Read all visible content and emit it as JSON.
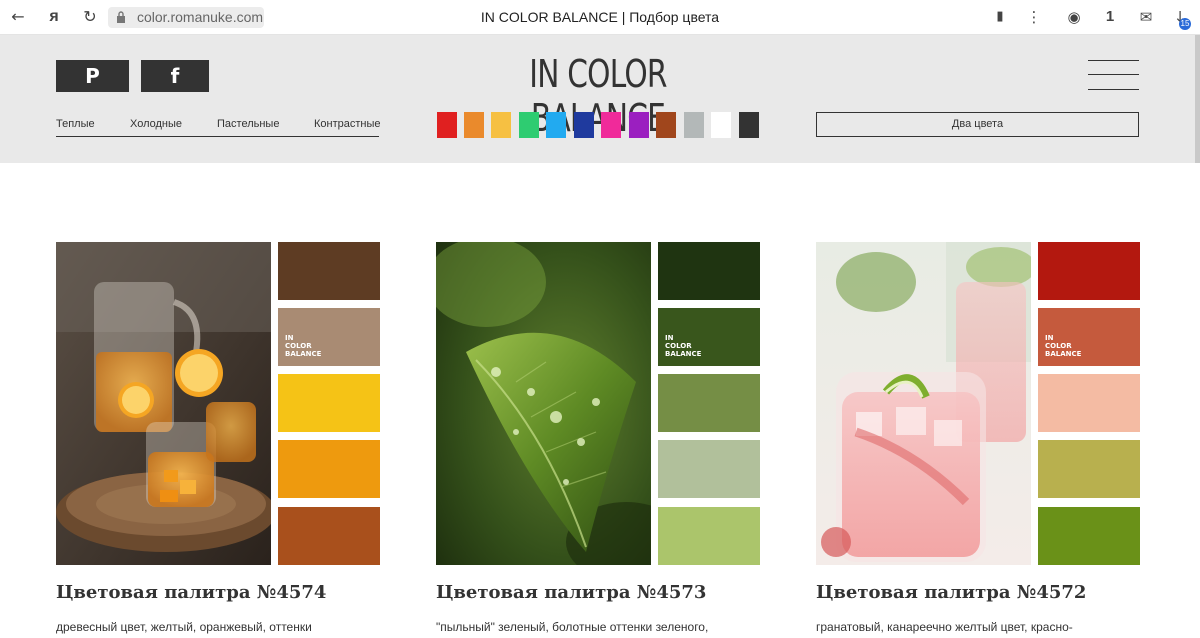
{
  "browser": {
    "url": "color.romanuke.com",
    "tab_title": "IN COLOR BALANCE | Подбор цвета",
    "badge_count": "15"
  },
  "header": {
    "logo": "IN COLOR BALANCE",
    "social": {
      "pinterest": "P",
      "facebook": "f"
    },
    "categories": [
      "Теплые",
      "Холодные",
      "Пастельные",
      "Контрастные"
    ],
    "color_filters": [
      "#e02020",
      "#ea8a2c",
      "#f6c042",
      "#2ecc71",
      "#22aaf0",
      "#1f3a9e",
      "#f02a9a",
      "#9b1fc0",
      "#a0461c",
      "#b3b8b8",
      "#ffffff",
      "#333333"
    ],
    "two_colors_button": "Два цвета"
  },
  "cards": [
    {
      "title": "Цветовая палитра №4574",
      "description": "древесный цвет, желтый, оранжевый, оттенки",
      "palette": [
        "#5e3c23",
        "#a98b73",
        "#f5c316",
        "#ee9a0e",
        "#a9501c"
      ],
      "palette_label": [
        "IN",
        "COLOR",
        "BALANCE"
      ]
    },
    {
      "title": "Цветовая палитра №4573",
      "description": "\"пыльный\" зеленый, болотные оттенки зеленого,",
      "palette": [
        "#1f3411",
        "#39561c",
        "#758e45",
        "#b1c09b",
        "#abc56b"
      ],
      "palette_label": [
        "IN",
        "COLOR",
        "BALANCE"
      ]
    },
    {
      "title": "Цветовая палитра №4572",
      "description": "гранатовый, канареечно желтый цвет, красно-",
      "palette": [
        "#b3180f",
        "#c55a3d",
        "#f4bba3",
        "#b8b04e",
        "#6a9118"
      ],
      "palette_label": [
        "IN",
        "COLOR",
        "BALANCE"
      ]
    }
  ]
}
